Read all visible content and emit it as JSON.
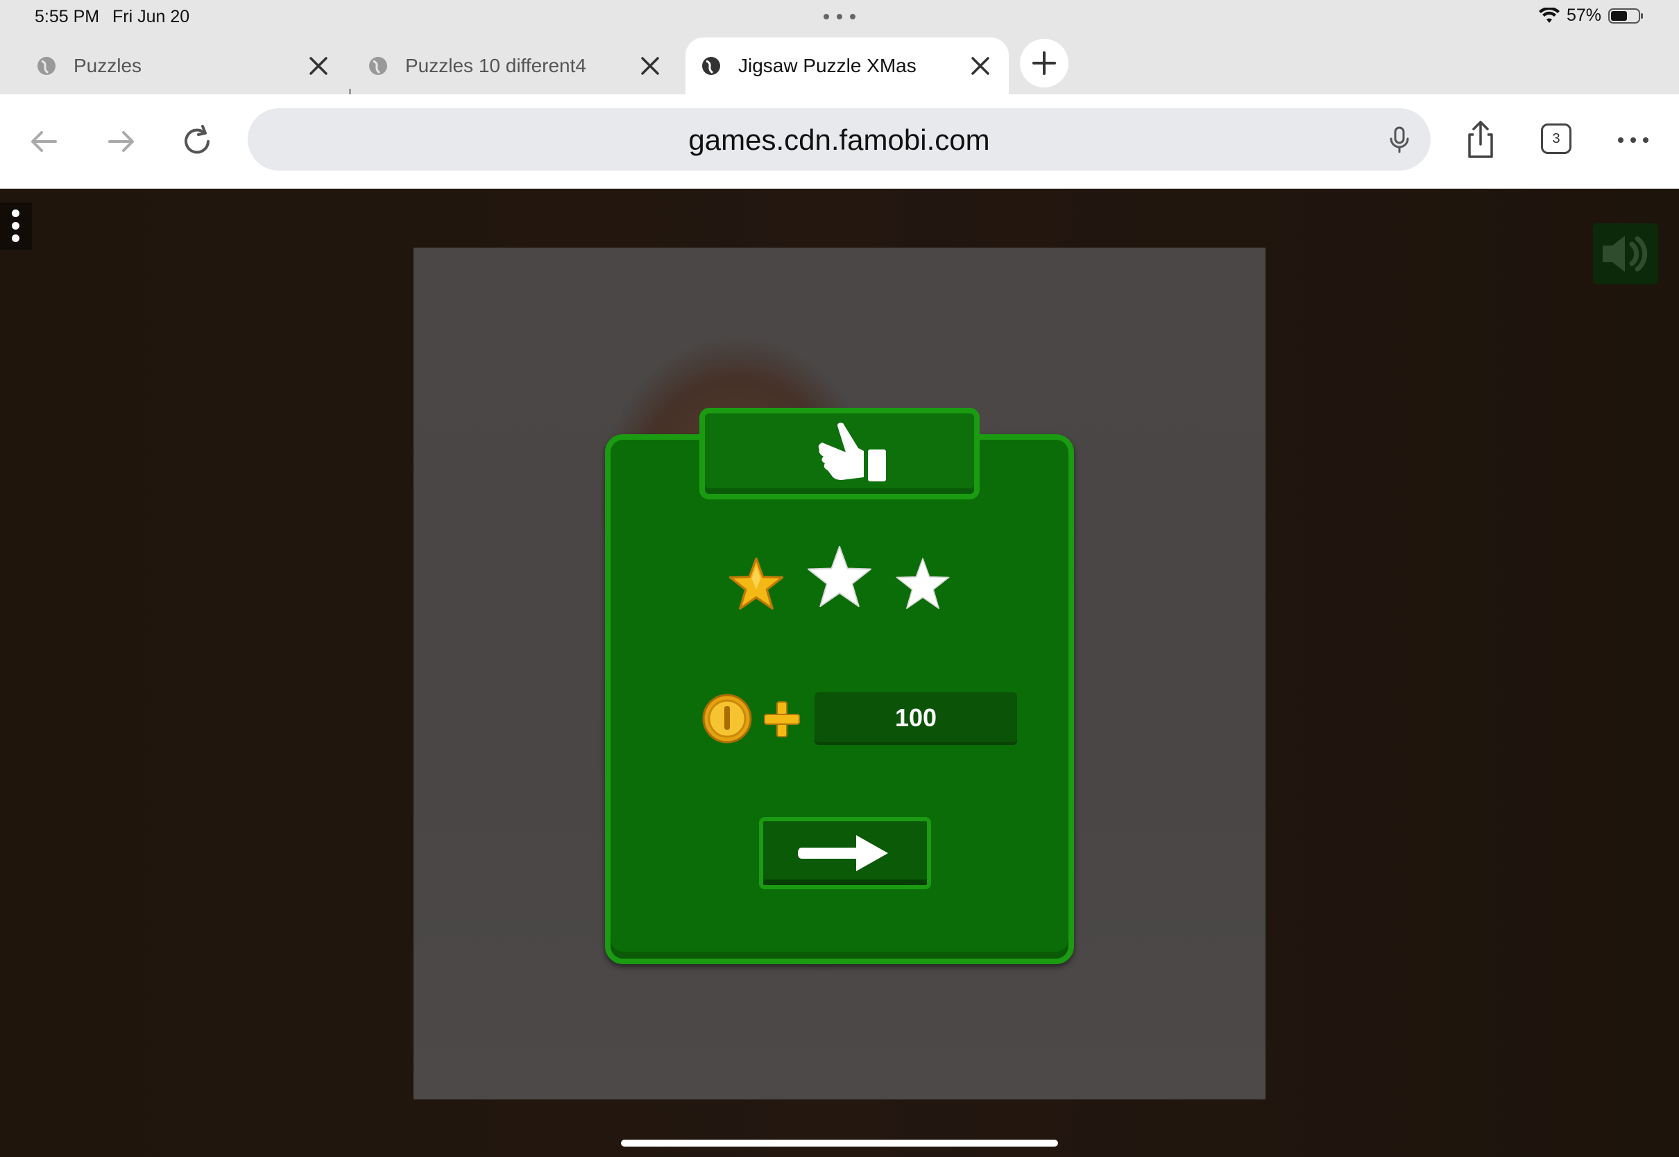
{
  "status_bar": {
    "time": "5:55 PM",
    "date": "Fri Jun 20",
    "battery": "57%"
  },
  "tabs": [
    {
      "title": "Puzzles",
      "active": false
    },
    {
      "title": "Puzzles 10 different4",
      "active": false
    },
    {
      "title": "Jigsaw Puzzle XMas",
      "active": true
    }
  ],
  "toolbar": {
    "url": "games.cdn.famobi.com",
    "tab_count": "3"
  },
  "game": {
    "stars_earned": 1,
    "stars_total": 3,
    "reward_value": "100",
    "icons": {
      "header": "thumbs-up-icon",
      "currency": "coin-icon",
      "next": "arrow-right-icon",
      "sound": "speaker-icon"
    },
    "colors": {
      "panel_green": "#0b6d08",
      "panel_border": "#1b9b12",
      "star_gold": "#f5b915",
      "star_white": "#ffffff"
    }
  }
}
